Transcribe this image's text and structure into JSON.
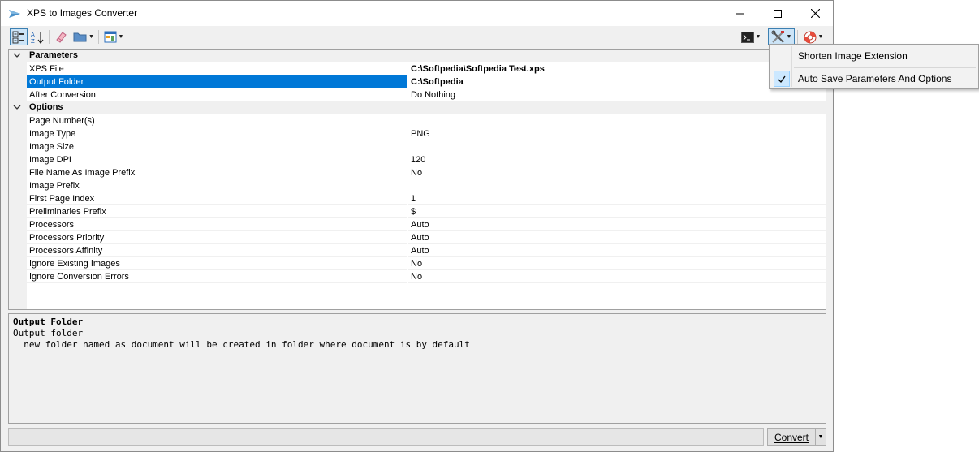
{
  "window": {
    "title": "XPS to Images Converter"
  },
  "toolbar": {
    "items": [
      "categorized-view",
      "alphabetical-sort",
      "eraser",
      "open-folder",
      "layout",
      "console",
      "tools",
      "help"
    ]
  },
  "grid": {
    "categories": [
      {
        "label": "Parameters",
        "rows": [
          {
            "name": "XPS File",
            "value": "C:\\Softpedia\\Softpedia Test.xps",
            "bold": true
          },
          {
            "name": "Output Folder",
            "value": "C:\\Softpedia",
            "bold": true,
            "selected": true
          },
          {
            "name": "After Conversion",
            "value": "Do Nothing"
          }
        ]
      },
      {
        "label": "Options",
        "rows": [
          {
            "name": "Page Number(s)",
            "value": ""
          },
          {
            "name": "Image Type",
            "value": "PNG"
          },
          {
            "name": "Image Size",
            "value": ""
          },
          {
            "name": "Image DPI",
            "value": "120"
          },
          {
            "name": "File Name As Image Prefix",
            "value": "No"
          },
          {
            "name": "Image Prefix",
            "value": ""
          },
          {
            "name": "First Page Index",
            "value": "1"
          },
          {
            "name": "Preliminaries Prefix",
            "value": "$"
          },
          {
            "name": "Processors",
            "value": "Auto"
          },
          {
            "name": "Processors Priority",
            "value": "Auto"
          },
          {
            "name": "Processors Affinity",
            "value": "Auto"
          },
          {
            "name": "Ignore Existing Images",
            "value": "No"
          },
          {
            "name": "Ignore Conversion Errors",
            "value": "No"
          }
        ]
      }
    ]
  },
  "help": {
    "title": "Output Folder",
    "description": "Output folder\n  new folder named as document will be created in folder where document is by default"
  },
  "footer": {
    "status": "",
    "convert_label": "Convert"
  },
  "menu": {
    "items": [
      {
        "label": "Shorten Image Extension",
        "checked": false
      },
      {
        "label": "Auto Save Parameters And Options",
        "checked": true
      }
    ]
  },
  "colors": {
    "selection": "#0078d7",
    "menu_check": "#cce8ff",
    "window_bg": "#f0f0f0"
  }
}
